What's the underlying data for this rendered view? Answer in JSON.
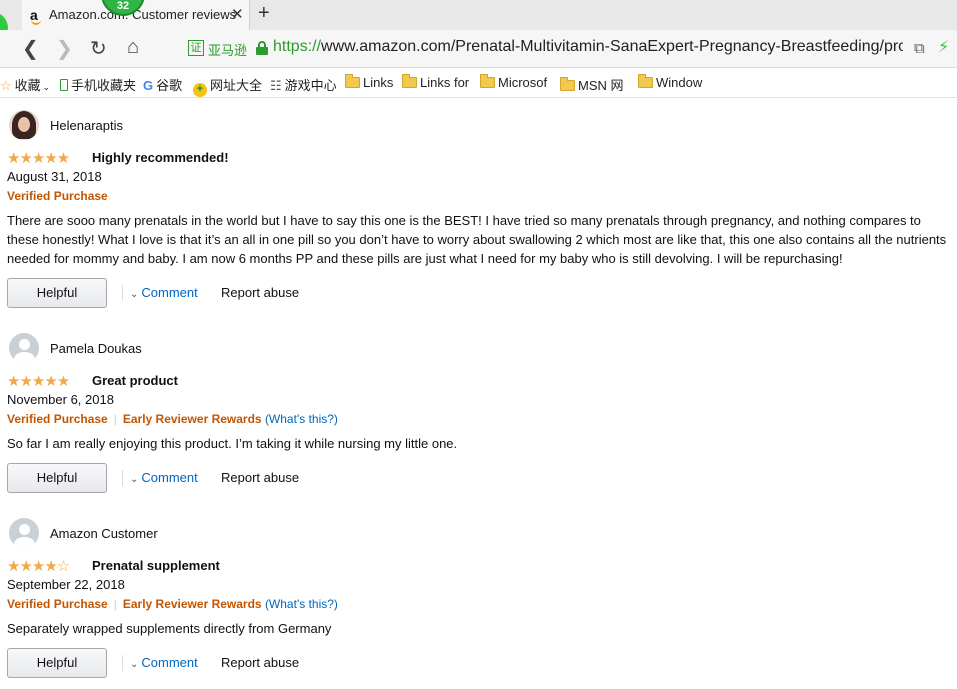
{
  "browser": {
    "tab": {
      "favicon": "a",
      "title": "Amazon.com: Customer reviews",
      "notification_count": "32"
    },
    "address": {
      "cert_label": "亚马逊",
      "url_scheme": "https://",
      "url_rest": "www.amazon.com/Prenatal-Multivitamin-SanaExpert-Pregnancy-Breastfeeding/produ"
    },
    "bookmarks": [
      {
        "label": "收藏",
        "icon": "star-icon"
      },
      {
        "label": "手机收藏夹",
        "icon": "phone-icon"
      },
      {
        "label": "谷歌",
        "icon": "google-icon"
      },
      {
        "label": "网址大全",
        "icon": "web-directory-icon"
      },
      {
        "label": "游戏中心",
        "icon": "gamepad-icon"
      },
      {
        "label": "Links",
        "icon": "folder-icon"
      },
      {
        "label": "Links for",
        "icon": "folder-icon"
      },
      {
        "label": "Microsof",
        "icon": "folder-icon"
      },
      {
        "label": "MSN 网",
        "icon": "folder-icon"
      },
      {
        "label": "Window",
        "icon": "folder-icon"
      }
    ]
  },
  "reviews": [
    {
      "reviewer": "Helenaraptis",
      "rating": 5,
      "stars": "★★★★★",
      "title": "Highly recommended!",
      "date": "August 31, 2018",
      "verified": "Verified Purchase",
      "early_reviewer": "",
      "whats_this": "",
      "body": "There are sooo many prenatals in the world but I have to say this one is the BEST! I have tried so many prenatals through pregnancy, and nothing compares to these honestly! What I love is that it’s an all in one pill so you don’t have to worry about swallowing 2 which most are like that, this one also contains all the nutrients needed for mommy and baby. I am now 6 months PP and these pills are just what I need for my baby who is still devolving. I will be repurchasing!",
      "helpful": "Helpful",
      "comment": "Comment",
      "report": "Report abuse"
    },
    {
      "reviewer": "Pamela Doukas",
      "rating": 5,
      "stars": "★★★★★",
      "title": "Great product",
      "date": "November 6, 2018",
      "verified": "Verified Purchase",
      "early_reviewer": "Early Reviewer Rewards",
      "whats_this": "(What's this?)",
      "body": "So far I am really enjoying this product. I’m taking it while nursing my little one.",
      "helpful": "Helpful",
      "comment": "Comment",
      "report": "Report abuse"
    },
    {
      "reviewer": "Amazon Customer",
      "rating": 4,
      "stars": "★★★★",
      "stars_empty": "☆",
      "title": "Prenatal supplement",
      "date": "September 22, 2018",
      "verified": "Verified Purchase",
      "early_reviewer": "Early Reviewer Rewards",
      "whats_this": "(What's this?)",
      "body": "Separately wrapped supplements directly from Germany",
      "helpful": "Helpful",
      "comment": "Comment",
      "report": "Report abuse"
    }
  ],
  "colors": {
    "star": "#f3a847",
    "verified": "#c45500",
    "link": "#0066c0",
    "secure": "#2e9b2e"
  }
}
